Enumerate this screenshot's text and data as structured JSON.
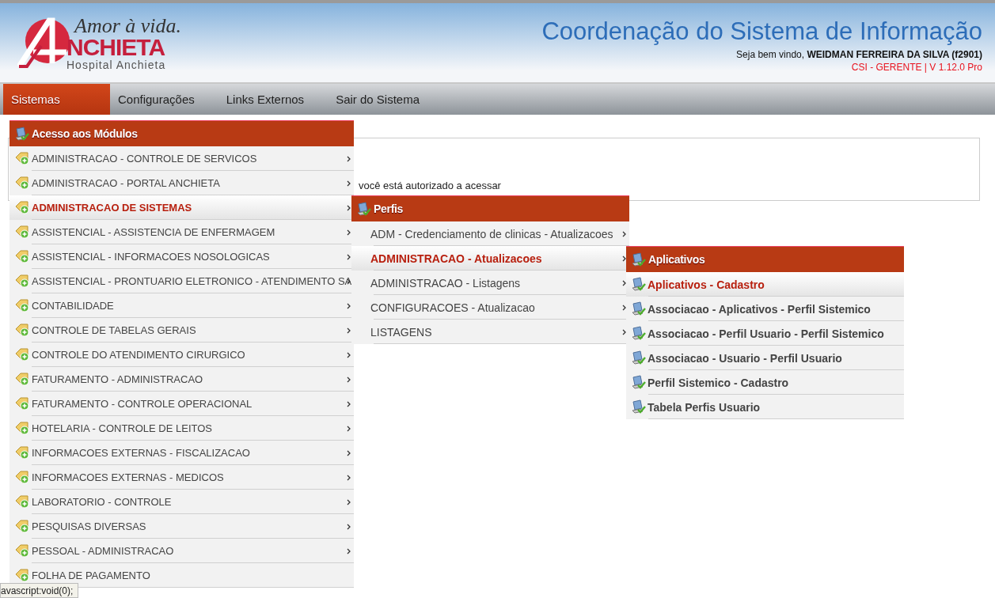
{
  "header": {
    "logo": {
      "slogan": "Amor à vida.",
      "name": "NCHIETA",
      "subtitle": "Hospital Anchieta"
    },
    "title": "Coordenação do Sistema de Informação",
    "welcome": "Seja bem vindo, **WEIDMAN FERREIRA DA SILVA (f2901)**",
    "role": "CSI - GERENTE | V 1.12.0 Pro"
  },
  "nav": [
    {
      "label": "Sistemas",
      "selected": true
    },
    {
      "label": "Configurações",
      "selected": false
    },
    {
      "label": "Links Externos",
      "selected": false
    },
    {
      "label": "Sair do Sistema",
      "selected": false
    }
  ],
  "content": {
    "text": "você está autorizado a acessar"
  },
  "menus": [
    {
      "title": "Acesso aos Módulos",
      "kind": "modules",
      "items": [
        {
          "label": "ADMINISTRACAO - CONTROLE DE SERVICOS",
          "selected": false,
          "has_submenu": true
        },
        {
          "label": "ADMINISTRACAO - PORTAL ANCHIETA",
          "selected": false,
          "has_submenu": true
        },
        {
          "label": "ADMINISTRACAO DE SISTEMAS",
          "selected": true,
          "has_submenu": true
        },
        {
          "label": "ASSISTENCIAL - ASSISTENCIA DE ENFERMAGEM",
          "selected": false,
          "has_submenu": true
        },
        {
          "label": "ASSISTENCIAL - INFORMACOES NOSOLOGICAS",
          "selected": false,
          "has_submenu": true
        },
        {
          "label": "ASSISTENCIAL - PRONTUARIO ELETRONICO - ATENDIMENTO SA",
          "selected": false,
          "has_submenu": true
        },
        {
          "label": "CONTABILIDADE",
          "selected": false,
          "has_submenu": true
        },
        {
          "label": "CONTROLE DE TABELAS GERAIS",
          "selected": false,
          "has_submenu": true
        },
        {
          "label": "CONTROLE DO ATENDIMENTO CIRURGICO",
          "selected": false,
          "has_submenu": true
        },
        {
          "label": "FATURAMENTO - ADMINISTRACAO",
          "selected": false,
          "has_submenu": true
        },
        {
          "label": "FATURAMENTO - CONTROLE OPERACIONAL",
          "selected": false,
          "has_submenu": true
        },
        {
          "label": "HOTELARIA - CONTROLE DE LEITOS",
          "selected": false,
          "has_submenu": true
        },
        {
          "label": "INFORMACOES EXTERNAS - FISCALIZACAO",
          "selected": false,
          "has_submenu": true
        },
        {
          "label": "INFORMACOES EXTERNAS - MEDICOS",
          "selected": false,
          "has_submenu": true
        },
        {
          "label": "LABORATORIO - CONTROLE",
          "selected": false,
          "has_submenu": true
        },
        {
          "label": "PESQUISAS DIVERSAS",
          "selected": false,
          "has_submenu": true
        },
        {
          "label": "PESSOAL - ADMINISTRACAO",
          "selected": false,
          "has_submenu": true
        },
        {
          "label": "FOLHA DE PAGAMENTO",
          "selected": false,
          "has_submenu": false
        }
      ]
    },
    {
      "title": "Perfis",
      "kind": "profiles",
      "items": [
        {
          "label": "ADM - Credenciamento de clinicas - Atualizacoes",
          "selected": false,
          "has_submenu": true
        },
        {
          "label": "ADMINISTRACAO - Atualizacoes",
          "selected": true,
          "has_submenu": true
        },
        {
          "label": "ADMINISTRACAO - Listagens",
          "selected": false,
          "has_submenu": true
        },
        {
          "label": "CONFIGURACOES - Atualizacao",
          "selected": false,
          "has_submenu": true
        },
        {
          "label": "LISTAGENS",
          "selected": false,
          "has_submenu": true
        }
      ]
    },
    {
      "title": "Aplicativos",
      "kind": "applications",
      "items": [
        {
          "label": "Aplicativos - Cadastro",
          "selected": true,
          "has_submenu": false
        },
        {
          "label": "Associacao - Aplicativos - Perfil Sistemico",
          "selected": false,
          "has_submenu": false
        },
        {
          "label": "Associacao - Perfil Usuario - Perfil Sistemico",
          "selected": false,
          "has_submenu": false
        },
        {
          "label": "Associacao - Usuario - Perfil Usuario",
          "selected": false,
          "has_submenu": false
        },
        {
          "label": "Perfil Sistemico - Cadastro",
          "selected": false,
          "has_submenu": false
        },
        {
          "label": "Tabela Perfis Usuario",
          "selected": false,
          "has_submenu": false
        }
      ]
    }
  ],
  "status_bar": {
    "text": "avascript:void(0);"
  }
}
